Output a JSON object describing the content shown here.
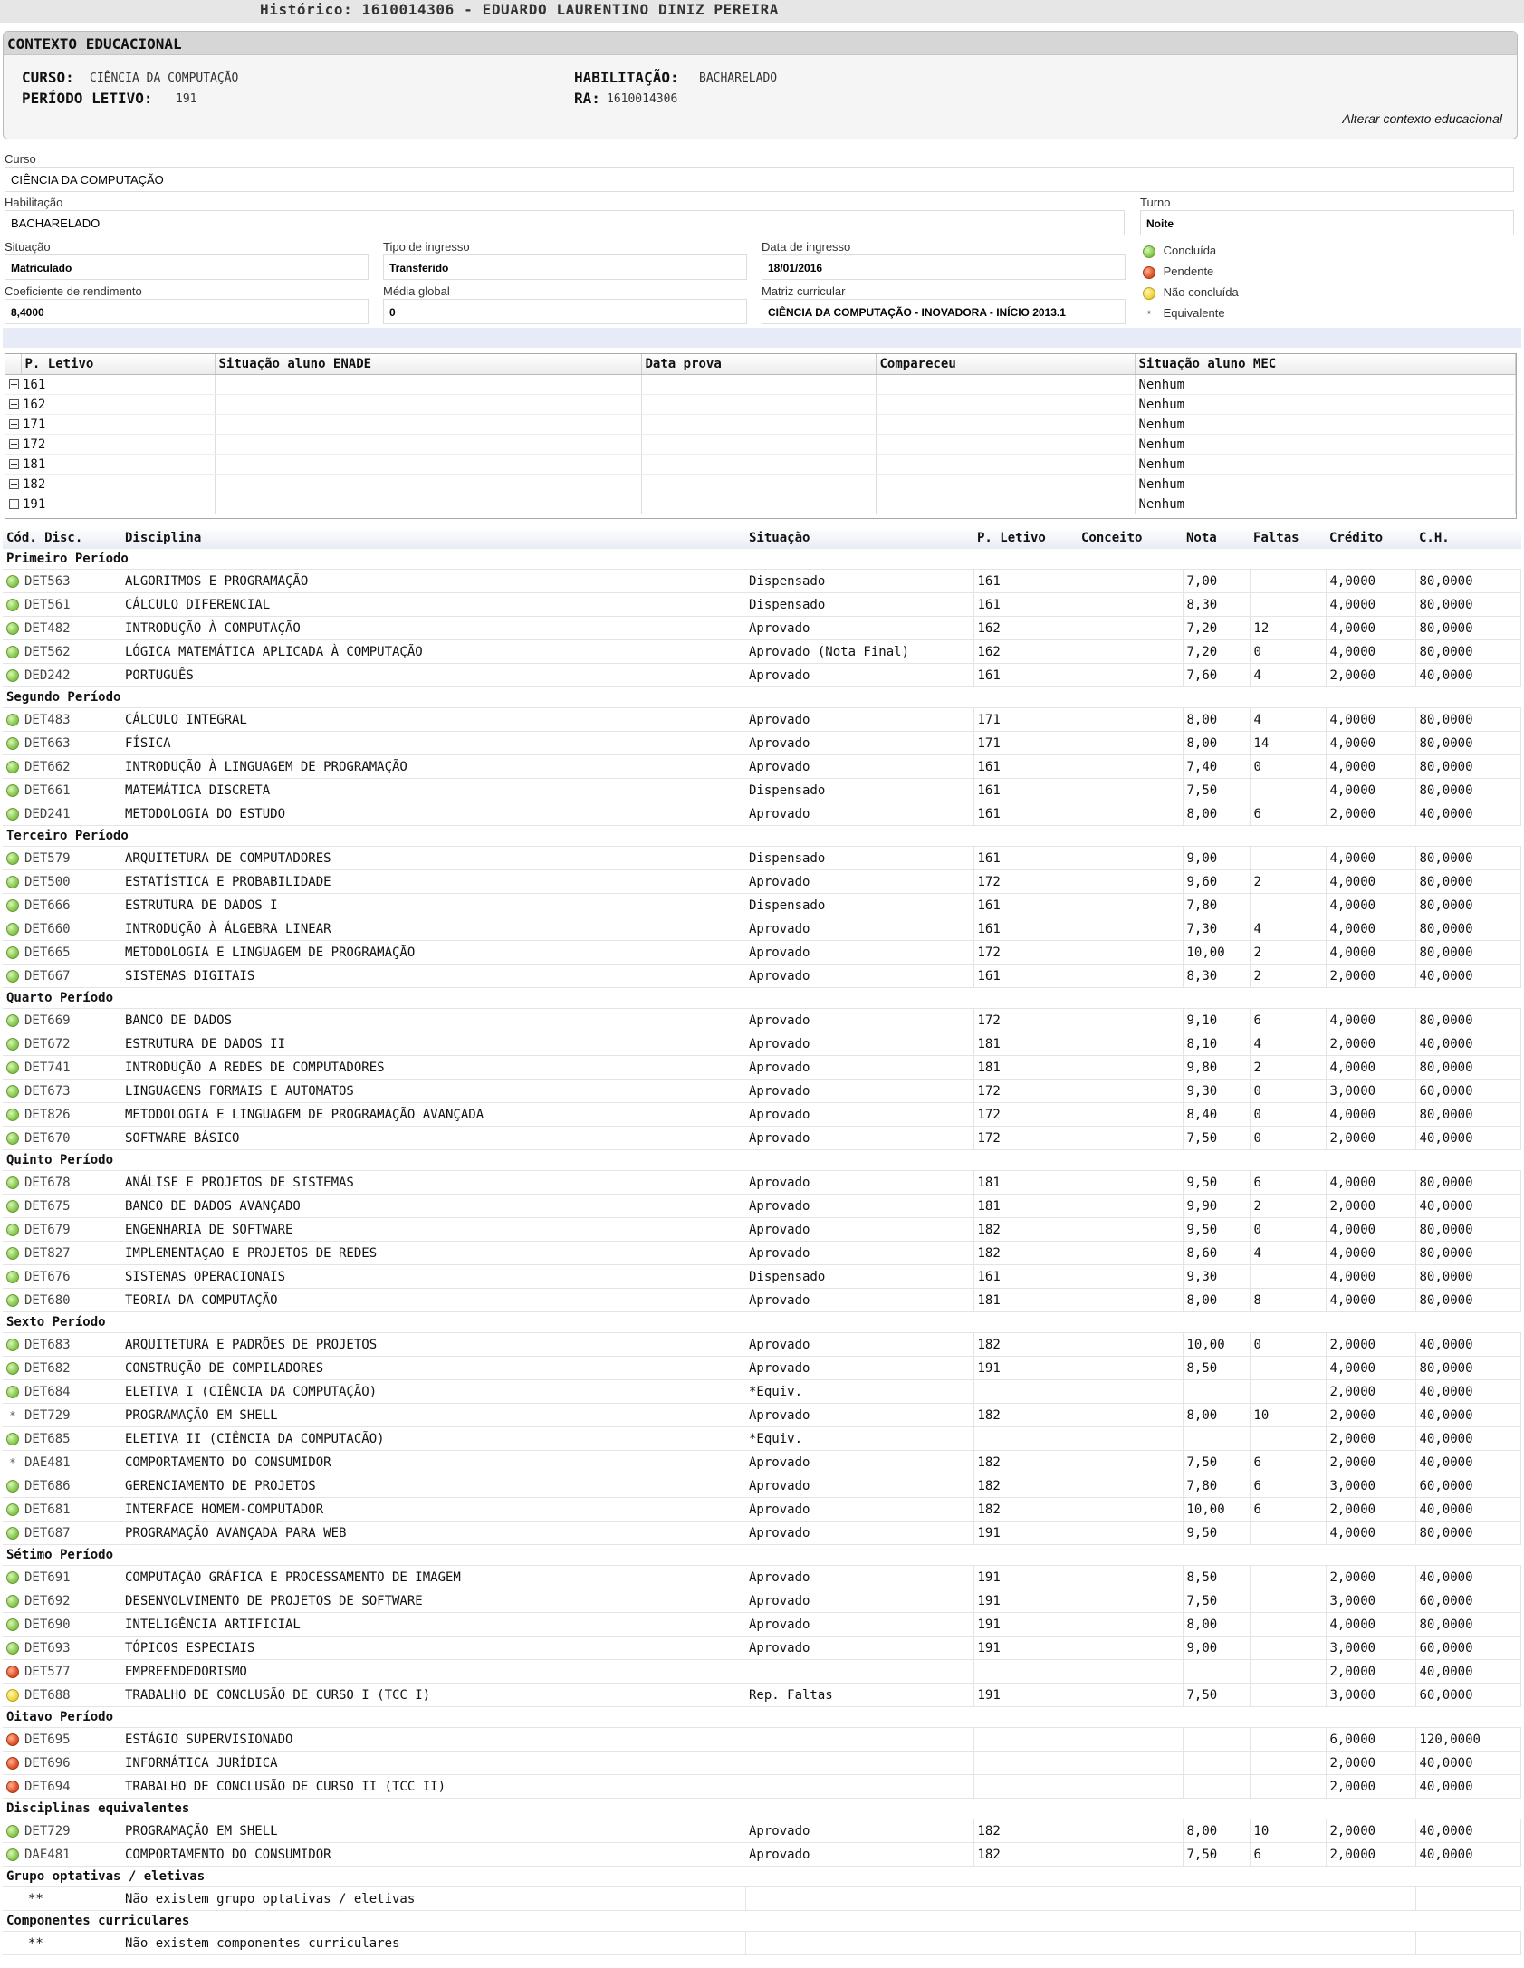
{
  "top_title": "Histórico: 1610014306 - EDUARDO LAURENTINO DINIZ PEREIRA",
  "context": {
    "header": "CONTEXTO EDUCACIONAL",
    "curso_label": "CURSO:",
    "curso_value": "CIÊNCIA DA COMPUTAÇÃO",
    "periodo_label": "PERÍODO LETIVO:",
    "periodo_value": "191",
    "habilitacao_label": "HABILITAÇÃO:",
    "habilitacao_value": "BACHARELADO",
    "ra_label": "RA:",
    "ra_value": "1610014306",
    "alterar_link": "Alterar contexto educacional"
  },
  "form": {
    "curso_label": "Curso",
    "curso": "CIÊNCIA DA COMPUTAÇÃO",
    "habilitacao_label": "Habilitação",
    "habilitacao": "BACHARELADO",
    "turno_label": "Turno",
    "turno": "Noite",
    "situacao_label": "Situação",
    "situacao": "Matriculado",
    "tipo_label": "Tipo de ingresso",
    "tipo": "Transferido",
    "data_label": "Data de ingresso",
    "data": "18/01/2016",
    "coef_label": "Coeficiente de rendimento",
    "coef": "8,4000",
    "media_label": "Média global",
    "media": "0",
    "matriz_label": "Matriz curricular",
    "matriz": "CIÊNCIA DA COMPUTAÇÃO - INOVADORA - INÍCIO 2013.1"
  },
  "legend": [
    {
      "icon": "green",
      "label": "Concluída"
    },
    {
      "icon": "red",
      "label": "Pendente"
    },
    {
      "icon": "yellow",
      "label": "Não concluída"
    },
    {
      "icon": "star",
      "label": "Equivalente"
    }
  ],
  "enade": {
    "headers": [
      "P. Letivo",
      "Situação aluno ENADE",
      "Data prova",
      "Compareceu",
      "Situação aluno MEC"
    ],
    "rows": [
      [
        "161",
        "",
        "",
        "",
        "Nenhum"
      ],
      [
        "162",
        "",
        "",
        "",
        "Nenhum"
      ],
      [
        "171",
        "",
        "",
        "",
        "Nenhum"
      ],
      [
        "172",
        "",
        "",
        "",
        "Nenhum"
      ],
      [
        "181",
        "",
        "",
        "",
        "Nenhum"
      ],
      [
        "182",
        "",
        "",
        "",
        "Nenhum"
      ],
      [
        "191",
        "",
        "",
        "",
        "Nenhum"
      ]
    ]
  },
  "grades": {
    "headers": [
      "Cód. Disc.",
      "Disciplina",
      "Situação",
      "P. Letivo",
      "Conceito",
      "Nota",
      "Faltas",
      "Crédito",
      "C.H."
    ],
    "sections": [
      {
        "title": "Primeiro Período",
        "rows": [
          [
            "green",
            "DET563",
            "ALGORITMOS E PROGRAMAÇÃO",
            "Dispensado",
            "161",
            "",
            "7,00",
            "",
            "4,0000",
            "80,0000"
          ],
          [
            "green",
            "DET561",
            "CÁLCULO DIFERENCIAL",
            "Dispensado",
            "161",
            "",
            "8,30",
            "",
            "4,0000",
            "80,0000"
          ],
          [
            "green",
            "DET482",
            "INTRODUÇÃO À COMPUTAÇÃO",
            "Aprovado",
            "162",
            "",
            "7,20",
            "12",
            "4,0000",
            "80,0000"
          ],
          [
            "green",
            "DET562",
            "LÓGICA MATEMÁTICA APLICADA À COMPUTAÇÃO",
            "Aprovado (Nota Final)",
            "162",
            "",
            "7,20",
            "0",
            "4,0000",
            "80,0000"
          ],
          [
            "green",
            "DED242",
            "PORTUGUÊS",
            "Aprovado",
            "161",
            "",
            "7,60",
            "4",
            "2,0000",
            "40,0000"
          ]
        ]
      },
      {
        "title": "Segundo Período",
        "rows": [
          [
            "green",
            "DET483",
            "CÁLCULO INTEGRAL",
            "Aprovado",
            "171",
            "",
            "8,00",
            "4",
            "4,0000",
            "80,0000"
          ],
          [
            "green",
            "DET663",
            "FÍSICA",
            "Aprovado",
            "171",
            "",
            "8,00",
            "14",
            "4,0000",
            "80,0000"
          ],
          [
            "green",
            "DET662",
            "INTRODUÇÃO À LINGUAGEM DE PROGRAMAÇÃO",
            "Aprovado",
            "161",
            "",
            "7,40",
            "0",
            "4,0000",
            "80,0000"
          ],
          [
            "green",
            "DET661",
            "MATEMÁTICA DISCRETA",
            "Dispensado",
            "161",
            "",
            "7,50",
            "",
            "4,0000",
            "80,0000"
          ],
          [
            "green",
            "DED241",
            "METODOLOGIA DO ESTUDO",
            "Aprovado",
            "161",
            "",
            "8,00",
            "6",
            "2,0000",
            "40,0000"
          ]
        ]
      },
      {
        "title": "Terceiro Período",
        "rows": [
          [
            "green",
            "DET579",
            "ARQUITETURA DE COMPUTADORES",
            "Dispensado",
            "161",
            "",
            "9,00",
            "",
            "4,0000",
            "80,0000"
          ],
          [
            "green",
            "DET500",
            "ESTATÍSTICA E PROBABILIDADE",
            "Aprovado",
            "172",
            "",
            "9,60",
            "2",
            "4,0000",
            "80,0000"
          ],
          [
            "green",
            "DET666",
            "ESTRUTURA DE DADOS I",
            "Dispensado",
            "161",
            "",
            "7,80",
            "",
            "4,0000",
            "80,0000"
          ],
          [
            "green",
            "DET660",
            "INTRODUÇÃO À ÁLGEBRA LINEAR",
            "Aprovado",
            "161",
            "",
            "7,30",
            "4",
            "4,0000",
            "80,0000"
          ],
          [
            "green",
            "DET665",
            "METODOLOGIA E LINGUAGEM DE PROGRAMAÇÃO",
            "Aprovado",
            "172",
            "",
            "10,00",
            "2",
            "4,0000",
            "80,0000"
          ],
          [
            "green",
            "DET667",
            "SISTEMAS DIGITAIS",
            "Aprovado",
            "161",
            "",
            "8,30",
            "2",
            "2,0000",
            "40,0000"
          ]
        ]
      },
      {
        "title": "Quarto Período",
        "rows": [
          [
            "green",
            "DET669",
            "BANCO DE DADOS",
            "Aprovado",
            "172",
            "",
            "9,10",
            "6",
            "4,0000",
            "80,0000"
          ],
          [
            "green",
            "DET672",
            "ESTRUTURA DE DADOS II",
            "Aprovado",
            "181",
            "",
            "8,10",
            "4",
            "2,0000",
            "40,0000"
          ],
          [
            "green",
            "DET741",
            "INTRODUÇÃO A REDES DE COMPUTADORES",
            "Aprovado",
            "181",
            "",
            "9,80",
            "2",
            "4,0000",
            "80,0000"
          ],
          [
            "green",
            "DET673",
            "LINGUAGENS FORMAIS E AUTOMATOS",
            "Aprovado",
            "172",
            "",
            "9,30",
            "0",
            "3,0000",
            "60,0000"
          ],
          [
            "green",
            "DET826",
            "METODOLOGIA E LINGUAGEM DE PROGRAMAÇÃO AVANÇADA",
            "Aprovado",
            "172",
            "",
            "8,40",
            "0",
            "4,0000",
            "80,0000"
          ],
          [
            "green",
            "DET670",
            "SOFTWARE BÁSICO",
            "Aprovado",
            "172",
            "",
            "7,50",
            "0",
            "2,0000",
            "40,0000"
          ]
        ]
      },
      {
        "title": "Quinto Período",
        "rows": [
          [
            "green",
            "DET678",
            "ANÁLISE E PROJETOS DE SISTEMAS",
            "Aprovado",
            "181",
            "",
            "9,50",
            "6",
            "4,0000",
            "80,0000"
          ],
          [
            "green",
            "DET675",
            "BANCO DE DADOS AVANÇADO",
            "Aprovado",
            "181",
            "",
            "9,90",
            "2",
            "2,0000",
            "40,0000"
          ],
          [
            "green",
            "DET679",
            "ENGENHARIA DE SOFTWARE",
            "Aprovado",
            "182",
            "",
            "9,50",
            "0",
            "4,0000",
            "80,0000"
          ],
          [
            "green",
            "DET827",
            "IMPLEMENTAÇAO E PROJETOS DE REDES",
            "Aprovado",
            "182",
            "",
            "8,60",
            "4",
            "4,0000",
            "80,0000"
          ],
          [
            "green",
            "DET676",
            "SISTEMAS OPERACIONAIS",
            "Dispensado",
            "161",
            "",
            "9,30",
            "",
            "4,0000",
            "80,0000"
          ],
          [
            "green",
            "DET680",
            "TEORIA DA COMPUTAÇÃO",
            "Aprovado",
            "181",
            "",
            "8,00",
            "8",
            "4,0000",
            "80,0000"
          ]
        ]
      },
      {
        "title": "Sexto Período",
        "rows": [
          [
            "green",
            "DET683",
            "ARQUITETURA E PADRÕES DE PROJETOS",
            "Aprovado",
            "182",
            "",
            "10,00",
            "0",
            "2,0000",
            "40,0000"
          ],
          [
            "green",
            "DET682",
            "CONSTRUÇÃO DE COMPILADORES",
            "Aprovado",
            "191",
            "",
            "8,50",
            "",
            "4,0000",
            "80,0000"
          ],
          [
            "green",
            "DET684",
            "ELETIVA I (CIÊNCIA DA COMPUTAÇÃO)",
            "*Equiv.",
            "",
            "",
            "",
            "",
            "2,0000",
            "40,0000"
          ],
          [
            "star",
            "DET729",
            "PROGRAMAÇÃO EM SHELL",
            "Aprovado",
            "182",
            "",
            "8,00",
            "10",
            "2,0000",
            "40,0000"
          ],
          [
            "green",
            "DET685",
            "ELETIVA II (CIÊNCIA DA COMPUTAÇÃO)",
            "*Equiv.",
            "",
            "",
            "",
            "",
            "2,0000",
            "40,0000"
          ],
          [
            "star",
            "DAE481",
            "COMPORTAMENTO DO CONSUMIDOR",
            "Aprovado",
            "182",
            "",
            "7,50",
            "6",
            "2,0000",
            "40,0000"
          ],
          [
            "green",
            "DET686",
            "GERENCIAMENTO DE PROJETOS",
            "Aprovado",
            "182",
            "",
            "7,80",
            "6",
            "3,0000",
            "60,0000"
          ],
          [
            "green",
            "DET681",
            "INTERFACE HOMEM-COMPUTADOR",
            "Aprovado",
            "182",
            "",
            "10,00",
            "6",
            "2,0000",
            "40,0000"
          ],
          [
            "green",
            "DET687",
            "PROGRAMAÇÃO AVANÇADA PARA WEB",
            "Aprovado",
            "191",
            "",
            "9,50",
            "",
            "4,0000",
            "80,0000"
          ]
        ]
      },
      {
        "title": "Sétimo Período",
        "rows": [
          [
            "green",
            "DET691",
            "COMPUTAÇÃO GRÁFICA E PROCESSAMENTO DE IMAGEM",
            "Aprovado",
            "191",
            "",
            "8,50",
            "",
            "2,0000",
            "40,0000"
          ],
          [
            "green",
            "DET692",
            "DESENVOLVIMENTO DE PROJETOS DE SOFTWARE",
            "Aprovado",
            "191",
            "",
            "7,50",
            "",
            "3,0000",
            "60,0000"
          ],
          [
            "green",
            "DET690",
            "INTELIGÊNCIA ARTIFICIAL",
            "Aprovado",
            "191",
            "",
            "8,00",
            "",
            "4,0000",
            "80,0000"
          ],
          [
            "green",
            "DET693",
            "TÓPICOS ESPECIAIS",
            "Aprovado",
            "191",
            "",
            "9,00",
            "",
            "3,0000",
            "60,0000"
          ],
          [
            "red",
            "DET577",
            "EMPREENDEDORISMO",
            "",
            "",
            "",
            "",
            "",
            "2,0000",
            "40,0000"
          ],
          [
            "yellow",
            "DET688",
            "TRABALHO DE CONCLUSÃO DE CURSO I (TCC I)",
            "Rep. Faltas",
            "191",
            "",
            "7,50",
            "",
            "3,0000",
            "60,0000"
          ]
        ]
      },
      {
        "title": "Oitavo Período",
        "rows": [
          [
            "red",
            "DET695",
            "ESTÁGIO SUPERVISIONADO",
            "",
            "",
            "",
            "",
            "",
            "6,0000",
            "120,0000"
          ],
          [
            "red",
            "DET696",
            "INFORMÁTICA JURÍDICA",
            "",
            "",
            "",
            "",
            "",
            "2,0000",
            "40,0000"
          ],
          [
            "red",
            "DET694",
            "TRABALHO DE CONCLUSÃO DE CURSO II (TCC II)",
            "",
            "",
            "",
            "",
            "",
            "2,0000",
            "40,0000"
          ]
        ]
      },
      {
        "title": "Disciplinas equivalentes",
        "rows": [
          [
            "green",
            "DET729",
            "PROGRAMAÇÃO EM SHELL",
            "Aprovado",
            "182",
            "",
            "8,00",
            "10",
            "2,0000",
            "40,0000"
          ],
          [
            "green",
            "DAE481",
            "COMPORTAMENTO DO CONSUMIDOR",
            "Aprovado",
            "182",
            "",
            "7,50",
            "6",
            "2,0000",
            "40,0000"
          ]
        ]
      }
    ],
    "optativas_title": "Grupo optativas / eletivas",
    "optativas_code": "**",
    "optativas_text": "Não existem grupo optativas / eletivas",
    "componentes_title": "Componentes curriculares",
    "componentes_code": "**",
    "componentes_text": "Não existem componentes curriculares"
  }
}
